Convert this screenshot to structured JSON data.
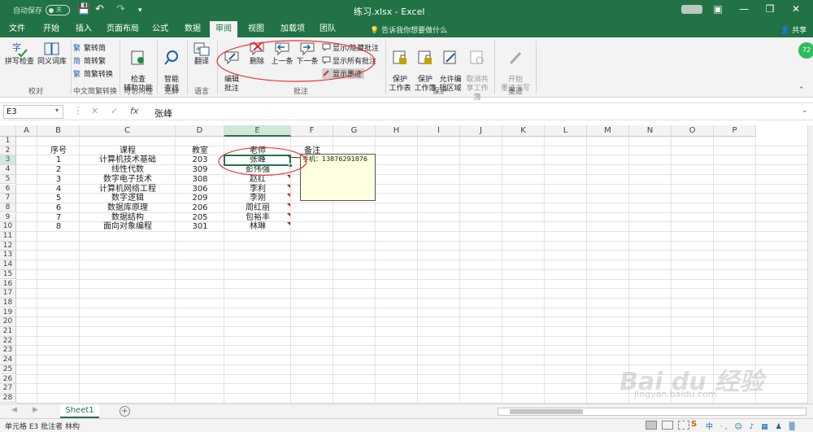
{
  "title": {
    "autosave_label": "自动保存",
    "autosave_state": "关",
    "filename": "练习.xlsx - Excel"
  },
  "tabs": [
    "文件",
    "开始",
    "插入",
    "页面布局",
    "公式",
    "数据",
    "审阅",
    "视图",
    "加载项",
    "团队"
  ],
  "active_tab": "审阅",
  "tell_me": "告诉我你想要做什么",
  "share": "共享",
  "ribbon": {
    "proof": {
      "spell": "拼写检查",
      "thesaurus": "同义词库",
      "group": "校对"
    },
    "chinese": {
      "to_trad": "繁转简",
      "to_simp": "简转繁",
      "conv": "简繁转换",
      "group": "中文简繁转换"
    },
    "access": {
      "check": "检查\n辅助功能",
      "group": "可访问性"
    },
    "insights": {
      "smart": "智能\n查找",
      "group": "见解"
    },
    "language": {
      "translate": "翻译",
      "group": "语言"
    },
    "comments": {
      "edit": "编辑\n批注",
      "delete": "删除",
      "prev": "上一条",
      "next": "下一条",
      "show_hide": "显示/隐藏批注",
      "show_all": "显示所有批注",
      "show_ink": "显示墨迹",
      "group": "批注"
    },
    "protect": {
      "sheet": "保护\n工作表",
      "workbook": "保护\n工作簿",
      "allow": "允许编\n辑区域",
      "unshare": "取消共\n享工作簿",
      "group": "保护"
    },
    "ink": {
      "start": "开始\n墨迹书写",
      "group": "墨迹"
    }
  },
  "ball_value": "72",
  "formula_bar": {
    "name_box": "E3",
    "fx": "fx",
    "value": "张峰"
  },
  "columns": [
    "A",
    "B",
    "C",
    "D",
    "E",
    "F",
    "G",
    "H",
    "I",
    "J",
    "K",
    "L",
    "M",
    "N",
    "O",
    "P"
  ],
  "rows": [
    "1",
    "2",
    "3",
    "4",
    "5",
    "6",
    "7",
    "8",
    "9",
    "10",
    "11",
    "12",
    "13",
    "14",
    "15",
    "16",
    "17",
    "18",
    "19",
    "20",
    "21",
    "22",
    "23",
    "24",
    "25",
    "26",
    "27",
    "28"
  ],
  "table": {
    "headers": [
      "序号",
      "课程",
      "教室",
      "老师",
      "备注"
    ],
    "data": [
      [
        "1",
        "计算机技术基础",
        "203",
        "张峰"
      ],
      [
        "2",
        "线性代数",
        "309",
        "彭伟强"
      ],
      [
        "3",
        "数字电子技术",
        "308",
        "赵红"
      ],
      [
        "4",
        "计算机网络工程",
        "306",
        "李利"
      ],
      [
        "5",
        "数字逻辑",
        "209",
        "李刚"
      ],
      [
        "6",
        "数据库原理",
        "206",
        "周红丽"
      ],
      [
        "7",
        "数据结构",
        "205",
        "包裕丰"
      ],
      [
        "8",
        "面向对象编程",
        "301",
        "林琳"
      ]
    ]
  },
  "comment_text": "手机：13876291876",
  "sheet_tab": "Sheet1",
  "status": "单元格 E3 批注者 林构",
  "sogou": "S",
  "sogou_tools": "中 ·, ☺ ♪ ▦ ♟ ▒",
  "watermark": "Bai du 经验",
  "watermark_url": "jingyan.baidu.com"
}
